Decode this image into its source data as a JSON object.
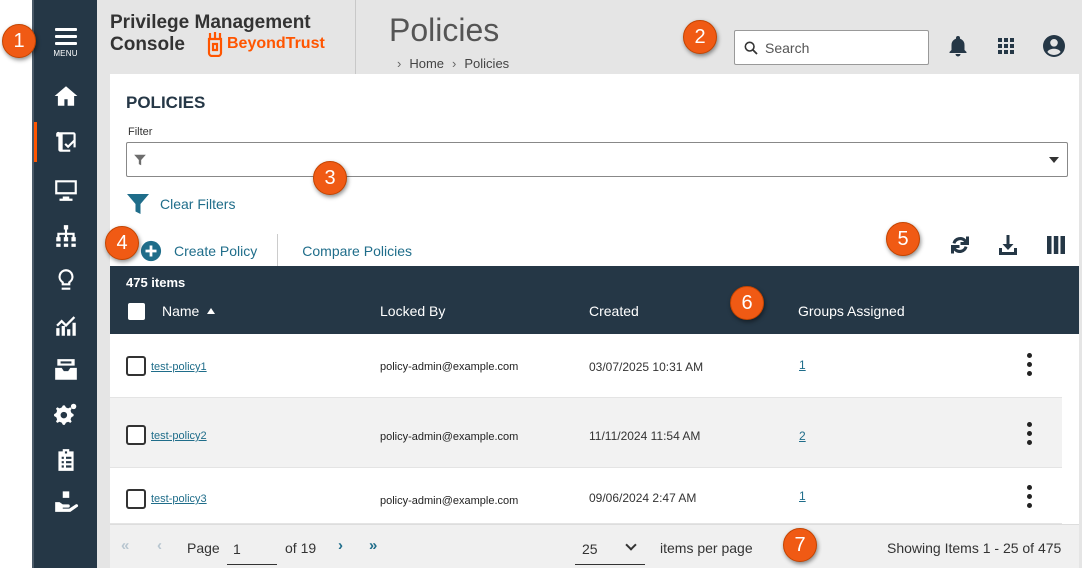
{
  "sidebar": {
    "menu_label": "MENU",
    "items": [
      {
        "icon": "home-icon"
      },
      {
        "icon": "policy-scroll-icon",
        "active": true
      },
      {
        "icon": "monitor-icon"
      },
      {
        "icon": "hierarchy-icon"
      },
      {
        "icon": "lightbulb-icon"
      },
      {
        "icon": "analytics-icon"
      },
      {
        "icon": "inbox-icon"
      },
      {
        "icon": "settings-gears-icon"
      },
      {
        "icon": "clipboard-list-icon"
      },
      {
        "icon": "hand-support-icon"
      }
    ]
  },
  "header": {
    "brand_line1": "Privilege Management",
    "brand_line2": "Console",
    "brand_company": "BeyondTrust",
    "page_title": "Policies",
    "breadcrumb": [
      "Home",
      "Policies"
    ],
    "search_placeholder": "Search"
  },
  "main": {
    "title": "POLICIES",
    "filter_label": "Filter",
    "clear_filters": "Clear Filters",
    "create_policy": "Create Policy",
    "compare_policies": "Compare Policies"
  },
  "table": {
    "count": "475 items",
    "columns": [
      "Name",
      "Locked By",
      "Created",
      "Groups Assigned"
    ],
    "rows": [
      {
        "name": "test-policy1",
        "locked_by": "policy-admin@example.com",
        "created": "03/07/2025 10:31 AM",
        "groups": "1"
      },
      {
        "name": "test-policy2",
        "locked_by": "policy-admin@example.com",
        "created": "11/11/2024 11:54 AM",
        "groups": "2"
      },
      {
        "name": "test-policy3",
        "locked_by": "policy-admin@example.com",
        "created": "09/06/2024 2:47 AM",
        "groups": "1"
      }
    ]
  },
  "pagination": {
    "page_label": "Page",
    "page": "1",
    "of": "of 19",
    "per_page": "25",
    "per_page_label": "items per page",
    "showing": "Showing Items 1 - 25 of 475"
  },
  "callouts": [
    "1",
    "2",
    "3",
    "4",
    "5",
    "6",
    "7"
  ],
  "colors": {
    "sidebar": "#253746",
    "accent": "#ff5500",
    "link": "#1f6d8a",
    "callout": "#f05a14"
  }
}
